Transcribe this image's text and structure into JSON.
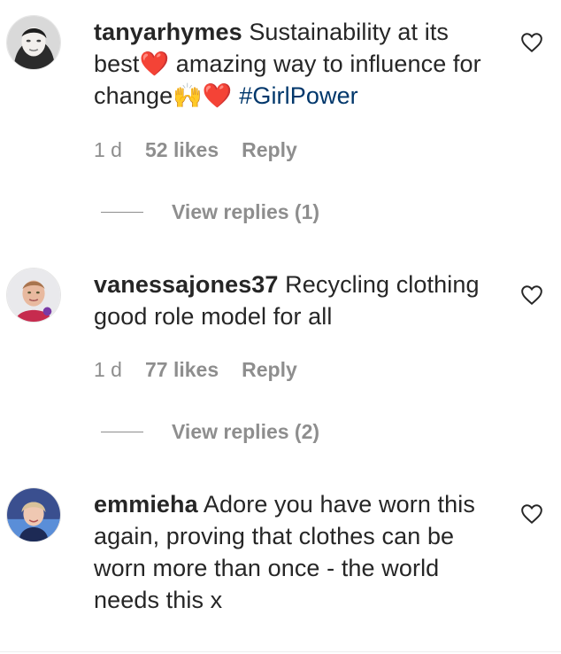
{
  "comments": [
    {
      "username": "tanyarhymes",
      "text_parts": [
        "Sustainability at its best",
        "❤️",
        " amazing way to influence for change",
        "🙌",
        "❤️",
        " ",
        "#GirlPower"
      ],
      "age": "1 d",
      "likes": "52 likes",
      "reply": "Reply",
      "view_replies": "View replies (1)"
    },
    {
      "username": "vanessajones37",
      "text": "Recycling clothing good role model for all",
      "age": "1 d",
      "likes": "77 likes",
      "reply": "Reply",
      "view_replies": "View replies (2)"
    },
    {
      "username": "emmieha",
      "text": "Adore you have worn this again, proving that clothes can be worn more than once - the world needs this x"
    }
  ],
  "icons": {
    "like": "heart-outline-icon",
    "avatar": "profile-photo"
  },
  "colors": {
    "text": "#262626",
    "secondary": "#8e8e8e",
    "hashtag": "#00376b",
    "heart": "#e0245e"
  }
}
